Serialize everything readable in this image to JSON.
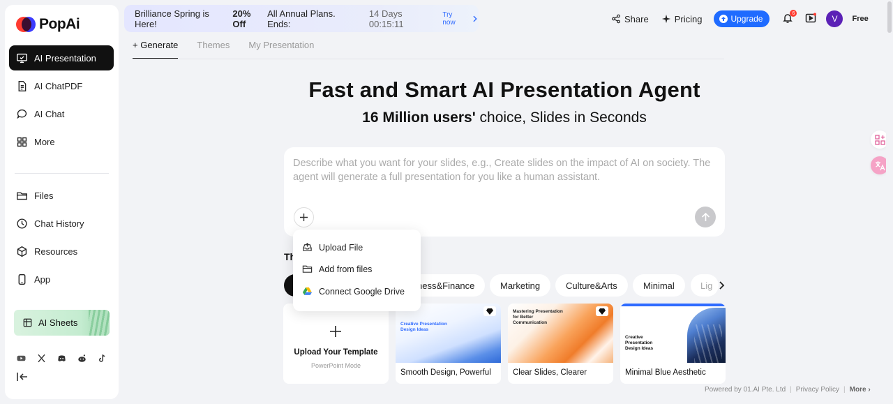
{
  "brand": {
    "name": "PopAi"
  },
  "sidebar": {
    "items": [
      {
        "label": "AI Presentation",
        "icon": "presentation-icon",
        "active": true
      },
      {
        "label": "AI ChatPDF",
        "icon": "document-icon"
      },
      {
        "label": "AI Chat",
        "icon": "chat-bubble-icon"
      },
      {
        "label": "More",
        "icon": "grid-icon"
      },
      {
        "label": "Files",
        "icon": "folder-icon"
      },
      {
        "label": "Chat History",
        "icon": "clock-icon"
      },
      {
        "label": "Resources",
        "icon": "cube-icon"
      },
      {
        "label": "App",
        "icon": "phone-icon"
      }
    ],
    "sheets_label": "AI Sheets",
    "socials": [
      "youtube-icon",
      "x-icon",
      "discord-icon",
      "reddit-icon",
      "tiktok-icon"
    ]
  },
  "promo": {
    "lead": "Brilliance Spring is Here!",
    "offer": "20% Off",
    "rest": "All Annual Plans. Ends:",
    "timer": "14 Days 00:15:11",
    "cta": "Try now"
  },
  "header": {
    "share": "Share",
    "pricing": "Pricing",
    "upgrade": "Upgrade",
    "notif_count": "6",
    "avatar_letter": "V",
    "plan": "Free"
  },
  "tabs": [
    {
      "label": "+ Generate",
      "active": true
    },
    {
      "label": "Themes"
    },
    {
      "label": "My Presentation"
    }
  ],
  "hero": {
    "title": "Fast and Smart AI Presentation Agent",
    "sub_bold": "16 Million users'",
    "sub_rest": "choice, Slides in Seconds"
  },
  "prompt": {
    "placeholder": "Describe what you want for your slides, e.g., Create slides on the impact of AI on society. The agent will generate a full presentation for you like a human assistant."
  },
  "dropdown": {
    "items": [
      {
        "label": "Upload File",
        "icon": "upload-tray-icon"
      },
      {
        "label": "Add from files",
        "icon": "folder-icon"
      },
      {
        "label": "Connect Google Drive",
        "icon": "google-drive-icon"
      }
    ]
  },
  "themes": {
    "label_partial": "Th",
    "chips": [
      "ness&Finance",
      "Marketing",
      "Culture&Arts",
      "Minimal",
      "Lig"
    ]
  },
  "cards": {
    "upload_title": "Upload Your Template",
    "upload_sub": "PowerPoint Mode",
    "templates": [
      {
        "title": "Smooth Design, Powerful Slides",
        "thumb_text": "Creative Presentation Design Ideas"
      },
      {
        "title": "Clear Slides, Clearer Connections",
        "thumb_text": "Mastering Presentation for Better Communication"
      },
      {
        "title": "Minimal Blue Aesthetic",
        "thumb_text": "Creative Presentation Design Ideas"
      }
    ]
  },
  "footer": {
    "powered": "Powered by 01.AI Pte. Ltd",
    "privacy": "Privacy Policy",
    "more": "More"
  },
  "colors": {
    "accent": "#1f6bff",
    "active_nav": "#111111",
    "background": "#f2f3f6"
  }
}
